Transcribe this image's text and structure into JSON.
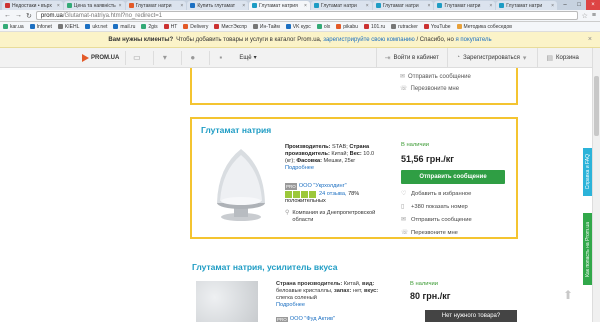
{
  "browser": {
    "tabs": [
      {
        "label": "Недостаки • върх",
        "color": "#c33",
        "active": false
      },
      {
        "label": "Цена та наявність",
        "color": "#3a7",
        "active": false
      },
      {
        "label": "Глутамат натри",
        "color": "#e35a28",
        "active": false
      },
      {
        "label": "Купить глутамат",
        "color": "#1b6fc2",
        "active": false
      },
      {
        "label": "Глутамат натрия",
        "color": "#1e9cc4",
        "active": true
      },
      {
        "label": "Глутамат натри",
        "color": "#1e9cc4",
        "active": false
      },
      {
        "label": "Глутамат натри",
        "color": "#1e9cc4",
        "active": false
      },
      {
        "label": "Глутамат натри",
        "color": "#1e9cc4",
        "active": false
      },
      {
        "label": "Глутамат натри",
        "color": "#1e9cc4",
        "active": false
      }
    ],
    "url_host": "prom.ua",
    "url_path": "/Glutamat-natriya.html?no_redirect=1",
    "bookmarks": [
      {
        "label": "kar.ua",
        "color": "#3a7"
      },
      {
        "label": "Infonet",
        "color": "#1b6fc2"
      },
      {
        "label": "KIEHL",
        "color": "#777"
      },
      {
        "label": "ukr.net",
        "color": "#1b6fc2"
      },
      {
        "label": "mail.ru",
        "color": "#1b6fc2"
      },
      {
        "label": "2gis",
        "color": "#3a7"
      },
      {
        "label": "HT",
        "color": "#c33"
      },
      {
        "label": "Delivery",
        "color": "#e35a28"
      },
      {
        "label": "МистЭкспр",
        "color": "#c33"
      },
      {
        "label": "Ин-Тайм",
        "color": "#777"
      },
      {
        "label": "VK курс",
        "color": "#1b6fc2"
      },
      {
        "label": "olx",
        "color": "#3a7"
      },
      {
        "label": "pikabu",
        "color": "#e35a28"
      },
      {
        "label": "101.ru",
        "color": "#c33"
      },
      {
        "label": "rutracker",
        "color": "#777"
      },
      {
        "label": "YouTube",
        "color": "#c33"
      },
      {
        "label": "Методика собеседов",
        "color": "#e8a13a"
      }
    ]
  },
  "notice": {
    "lead": "Вам нужны клиенты?",
    "text": "Чтобы добавить товары и услуги в каталог Prom.ua,",
    "link1": "зарегистрируйте свою компанию",
    "mid": "/ Спасибо, но",
    "link2": "я покупатель",
    "close": "×"
  },
  "header": {
    "logo": "PROM.UA",
    "more": "Ещё",
    "login": "Войти в кабинет",
    "register": "Зарегистрироваться",
    "cart": "Корзина"
  },
  "card_top": {
    "send_message": "Отправить сообщение",
    "call_me": "Перезвоните мне"
  },
  "product1": {
    "title": "Глутамат натрия",
    "desc_producer_label": "Производитель:",
    "desc_producer": "STAB;",
    "desc_country_label": "Страна производитель:",
    "desc_country": "Китай;",
    "desc_weight_label": "Вес:",
    "desc_weight": "10.0 (кг);",
    "desc_pack_label": "Фасовка:",
    "desc_pack": "Мешки, 25кг",
    "more": "Подробнее",
    "pro": "PRO",
    "company": "ООО \"Укрхолдинг\"",
    "reviews": "24 отзыва,",
    "positive": "78%",
    "positive_label": "положительных",
    "location": "Компания из Днепропетровской области",
    "stock": "В наличии",
    "price": "51,56 грн./кг",
    "order": "Отправить сообщение",
    "favorite": "Добавить в избранное",
    "phone": "+380",
    "show_number": "показать номер",
    "send_message": "Отправить сообщение",
    "call_me": "Перезвоните мне",
    "rating_value": 4
  },
  "product2": {
    "title": "Глутамат натрия, усилитель вкуса",
    "desc_country_label": "Страна производитель:",
    "desc_country": "Китай,",
    "desc_kind_label": "вид:",
    "desc_kind": "белоавые кристаллы,",
    "desc_smell_label": "запах:",
    "desc_smell": "нет,",
    "desc_taste_label": "вкус:",
    "desc_taste": "слегка соленый",
    "more": "Подробнее",
    "company": "ООО \"Фуд Актив\"",
    "stock": "В наличии",
    "price": "80 грн./кг"
  },
  "ribbons": {
    "faq": "Справка и FAQ",
    "howto": "Как попасть на Prom.ua"
  },
  "need_bar": "Нет нужного товара?"
}
